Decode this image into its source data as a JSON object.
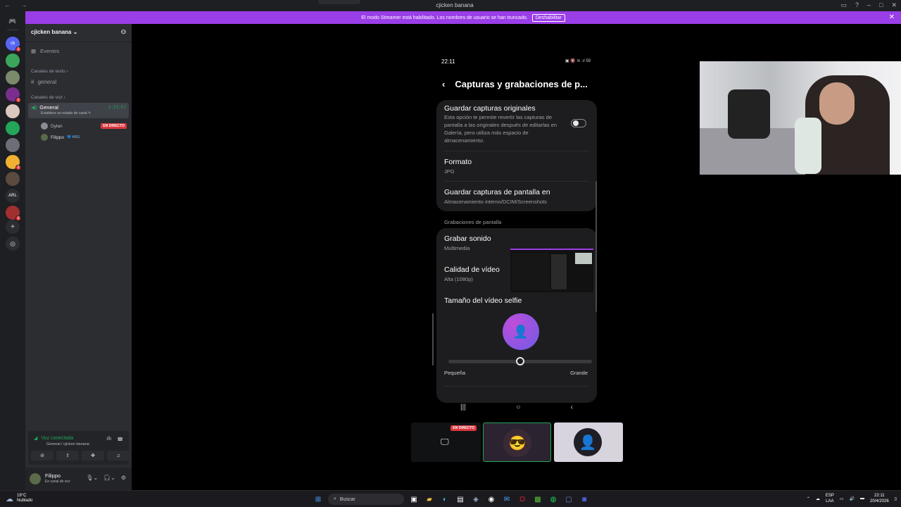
{
  "window": {
    "title": "cjicken banana",
    "nav": "←  →"
  },
  "banner": {
    "message": "El modo Streamer está habilitado. Los nombres de usuario se han truncado.",
    "disable_label": "Deshabilitar"
  },
  "rail": {
    "servers": [
      {
        "label": "cb",
        "color": "#5865f2",
        "badge": "1"
      },
      {
        "label": "",
        "color": "#3ba55c",
        "badge": ""
      },
      {
        "label": "",
        "color": "#7b8a6a",
        "badge": ""
      },
      {
        "label": "",
        "color": "#7a2e8e",
        "badge": "1"
      },
      {
        "label": "",
        "color": "#d8c8c0",
        "badge": ""
      },
      {
        "label": "",
        "color": "#23a55a",
        "badge": ""
      },
      {
        "label": "",
        "color": "#6d6f78",
        "badge": ""
      },
      {
        "label": "",
        "color": "#f0b132",
        "badge": "2"
      },
      {
        "label": "",
        "color": "#5a4a40",
        "badge": ""
      },
      {
        "label": "ARL",
        "color": "#2b2d31",
        "badge": ""
      },
      {
        "label": "",
        "color": "#a03030",
        "badge": "1"
      }
    ]
  },
  "sidebar": {
    "server_name": "cjicken banana",
    "events_label": "Eventos",
    "text_category": "Canales de texto",
    "text_channel": "general",
    "voice_category": "Canales de voz",
    "voice_channel": "General",
    "voice_status": "Establece un estado de canal ✎",
    "voice_timer": "1:23:57",
    "users": [
      {
        "name": "Dylan",
        "live": "EN DIRECTO"
      },
      {
        "name": "Filippo",
        "tag": "💙 ARG"
      }
    ]
  },
  "voice_panel": {
    "connected": "Voz conectada",
    "location": "General / cjicken banana"
  },
  "user_panel": {
    "name": "Filippo",
    "status": "En canal de voz"
  },
  "phone": {
    "time": "22:11",
    "status_icons": "▣ 🔇 ≋ .ıl 59",
    "header": "Capturas y grabaciones de p...",
    "save_originals_title": "Guardar capturas originales",
    "save_originals_desc": "Esta opción te permite revertir las capturas de pantalla a las originales después de editarlas en Galería, pero utiliza más espacio de almacenamiento.",
    "format_title": "Formato",
    "format_value": "JPG",
    "save_location_title": "Guardar capturas de pantalla en",
    "save_location_value": "Almacenamiento interno/DCIM/Screenshots",
    "section_recordings": "Grabaciones de pantalla",
    "record_sound_title": "Grabar sonido",
    "record_sound_value": "Multimedia",
    "video_quality_title": "Calidad de vídeo",
    "video_quality_value": "Alta (1080p)",
    "selfie_size_title": "Tamaño del vídeo selfie",
    "slider_min": "Pequeña",
    "slider_max": "Grande",
    "selfie_size_level": 0.5,
    "save_originals_toggle": false
  },
  "tiles": {
    "live_label": "EN DIRECTO"
  },
  "taskbar": {
    "temp": "19°C",
    "weather": "Nublado",
    "search": "Buscar",
    "lang1": "ESP",
    "lang2": "LAA",
    "time": "22:11",
    "date": "20/4/2026"
  },
  "colors": {
    "accent": "#9a3ee8",
    "voice_green": "#23a55a",
    "live_red": "#da373c"
  }
}
